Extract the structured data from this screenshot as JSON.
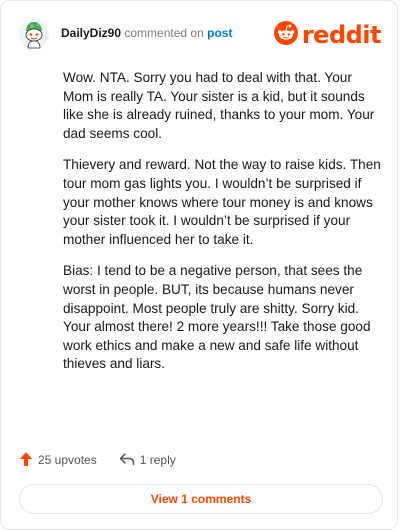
{
  "comment": {
    "username": "DailyDiz90",
    "commented_text": "commented on",
    "post_link": "post",
    "paragraphs": [
      "Wow. NTA. Sorry you had to deal with that. Your Mom is really TA. Your sister is a kid, but it sounds like she is already ruined, thanks to your mom. Your dad seems cool.",
      "Thievery and reward. Not the way to raise kids. Then tour mom gas lights you. I wouldn’t be surprised if your mother knows where tour money is and knows your sister took it. I wouldn’t be surprised if your mother influenced her to take it.",
      "Bias: I tend to be a negative person, that sees the worst in people. BUT, its because humans never disappoint. Most people truly are shitty. Sorry kid. Your almost there! 2 more years!!! Take those good work ethics and make a new and safe life without thieves and liars."
    ],
    "upvotes": "25 upvotes",
    "replies": "1 reply",
    "view_comments": "View 1 comments"
  },
  "brand": {
    "name": "reddit",
    "color": "#ff4500"
  },
  "colors": {
    "link": "#0079d3",
    "accent": "#ff4500",
    "text": "#1a1a1b",
    "muted": "#7c7c7c"
  },
  "icons": {
    "upvote": "arrow-up-icon",
    "reply": "reply-arrow-icon",
    "logo": "reddit-snoo-icon",
    "avatar": "snoo-avatar-icon"
  }
}
